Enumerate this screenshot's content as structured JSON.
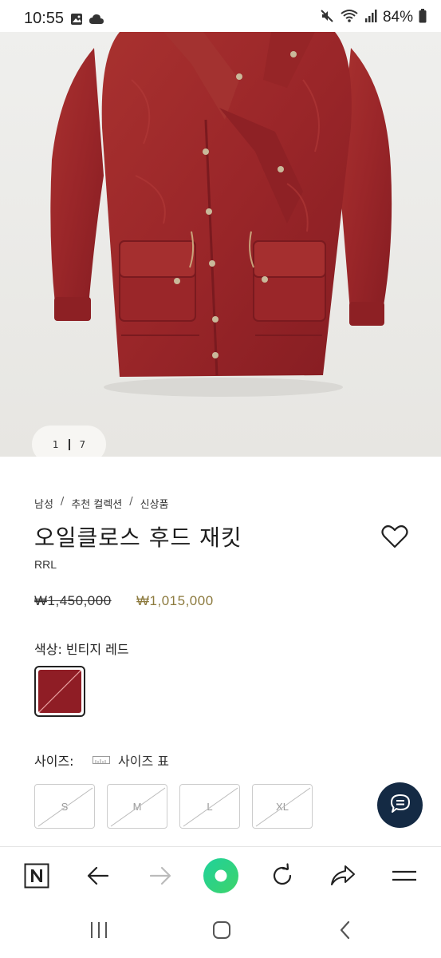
{
  "status_bar": {
    "time": "10:55",
    "battery": "84%",
    "icons": [
      "image-icon",
      "cloud-icon",
      "mute-icon",
      "wifi-icon",
      "signal-icon",
      "battery-icon"
    ]
  },
  "gallery": {
    "current": "1",
    "total": "7"
  },
  "product": {
    "breadcrumb": [
      "남성",
      "추천 컬렉션",
      "신상품"
    ],
    "title": "오일클로스 후드 재킷",
    "brand": "RRL",
    "price_original": "₩1,450,000",
    "price_sale": "₩1,015,000",
    "color_label": "색상: 빈티지 레드",
    "swatch_color": "#8f1d25",
    "size_label": "사이즈:",
    "size_chart_label": "사이즈 표",
    "sizes": [
      "S",
      "M",
      "L",
      "XL"
    ]
  },
  "colors": {
    "accent_price": "#8c7a3e",
    "fab": "#142a44",
    "jacket": "#9e2a2d"
  },
  "toolbar": {
    "icons": [
      "naver-n-icon",
      "back-arrow-icon",
      "forward-arrow-icon",
      "home-green-icon",
      "refresh-icon",
      "share-icon",
      "menu-icon"
    ]
  },
  "navbar": {
    "icons": [
      "recent-apps-icon",
      "home-icon",
      "back-icon"
    ]
  }
}
